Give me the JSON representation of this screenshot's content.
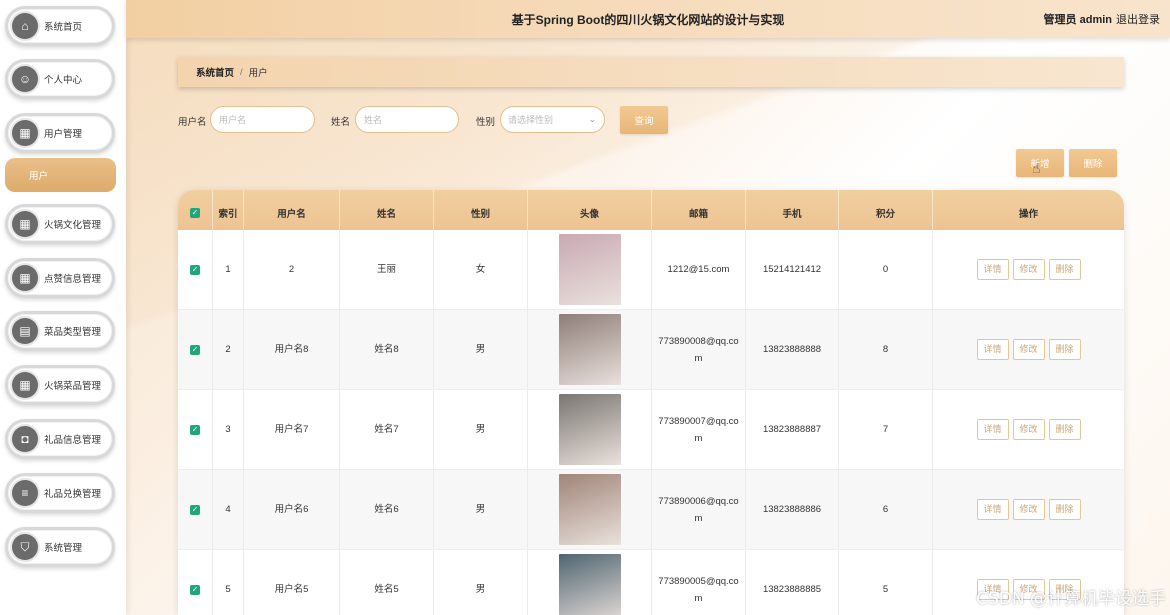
{
  "header": {
    "title": "基于Spring Boot的四川火锅文化网站的设计与实现",
    "user": "管理员 admin",
    "logout": "退出登录"
  },
  "sidebar": {
    "items": [
      {
        "label": "系统首页",
        "icon": "home-icon"
      },
      {
        "label": "个人中心",
        "icon": "user-icon"
      },
      {
        "label": "用户管理",
        "icon": "grid-icon"
      },
      {
        "label": "火锅文化管理",
        "icon": "grid-icon"
      },
      {
        "label": "点赞信息管理",
        "icon": "grid-icon"
      },
      {
        "label": "菜品类型管理",
        "icon": "document-icon"
      },
      {
        "label": "火锅菜品管理",
        "icon": "grid-icon"
      },
      {
        "label": "礼品信息管理",
        "icon": "bag-icon"
      },
      {
        "label": "礼品兑换管理",
        "icon": "list-icon"
      },
      {
        "label": "系统管理",
        "icon": "shield-icon"
      }
    ],
    "active_sub": "用户"
  },
  "breadcrumb": {
    "home": "系统首页",
    "sep": "/",
    "current": "用户"
  },
  "search": {
    "username_label": "用户名",
    "username_placeholder": "用户名",
    "name_label": "姓名",
    "name_placeholder": "姓名",
    "gender_label": "性别",
    "gender_placeholder": "请选择性别",
    "query_button": "查询"
  },
  "actions": {
    "add_button": "新增",
    "delete_button": "删除"
  },
  "table": {
    "columns": [
      "索引",
      "用户名",
      "姓名",
      "性别",
      "头像",
      "邮箱",
      "手机",
      "积分",
      "操作"
    ],
    "row_buttons": {
      "detail": "详情",
      "edit": "修改",
      "delete": "删除"
    },
    "rows": [
      {
        "index": "1",
        "username": "2",
        "name": "王丽",
        "gender": "女",
        "email": "1212@15.com",
        "phone": "15214121412",
        "points": "0",
        "avatar_color": "#c9a9b3"
      },
      {
        "index": "2",
        "username": "用户名8",
        "name": "姓名8",
        "gender": "男",
        "email": "773890008@qq.co m",
        "phone": "13823888888",
        "points": "8",
        "avatar_color": "#8e7d78"
      },
      {
        "index": "3",
        "username": "用户名7",
        "name": "姓名7",
        "gender": "男",
        "email": "773890007@qq.co m",
        "phone": "13823888887",
        "points": "7",
        "avatar_color": "#7b7672"
      },
      {
        "index": "4",
        "username": "用户名6",
        "name": "姓名6",
        "gender": "男",
        "email": "773890006@qq.co m",
        "phone": "13823888886",
        "points": "6",
        "avatar_color": "#a08478"
      },
      {
        "index": "5",
        "username": "用户名5",
        "name": "姓名5",
        "gender": "男",
        "email": "773890005@qq.co m",
        "phone": "13823888885",
        "points": "5",
        "avatar_color": "#4f6470"
      }
    ]
  },
  "watermark": "CSDN @计算机毕设选手",
  "colors": {
    "accent": "#e8b577",
    "check": "#1fa67a"
  }
}
